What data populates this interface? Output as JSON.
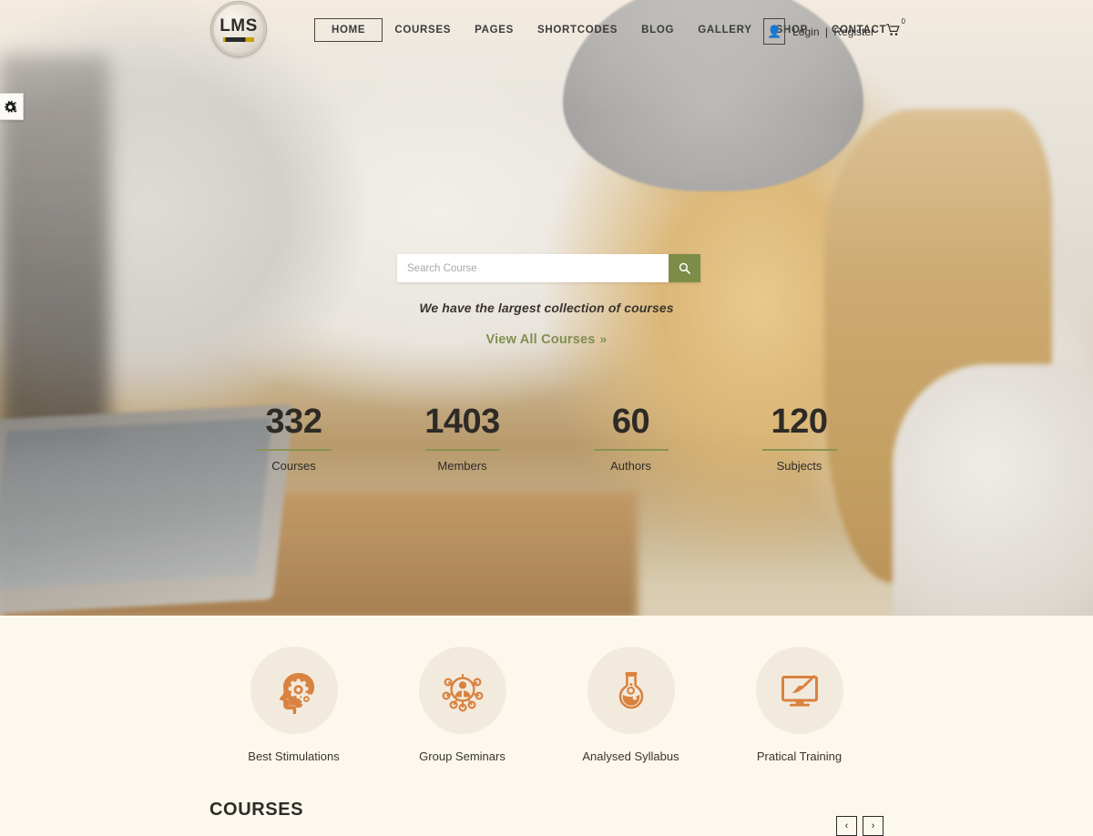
{
  "site": {
    "logo_text": "LMS",
    "accent_green": "#7d8c46",
    "accent_orange": "#d9823f",
    "section_bg": "#fdf8ee",
    "circle_bg": "#f3eade"
  },
  "header": {
    "nav_items": [
      {
        "label": "HOME",
        "active": true
      },
      {
        "label": "COURSES",
        "active": false
      },
      {
        "label": "PAGES",
        "active": false
      },
      {
        "label": "SHORTCODES",
        "active": false
      },
      {
        "label": "BLOG",
        "active": false
      },
      {
        "label": "GALLERY",
        "active": false
      },
      {
        "label": "SHOP",
        "active": false
      },
      {
        "label": "CONTACT",
        "active": false
      }
    ],
    "login_label": "Login",
    "separator": "|",
    "register_label": "Register",
    "cart_count": "0",
    "user_icon": "user-icon",
    "cart_icon": "cart-icon",
    "settings_icon": "settings-gears-icon"
  },
  "hero": {
    "search_placeholder": "Search Course",
    "search_value": "",
    "search_icon": "search-icon",
    "tagline": "We have the largest collection of courses",
    "view_all_label": "View All Courses",
    "view_all_chevron": "»"
  },
  "counters": [
    {
      "value": "332",
      "label": "Courses"
    },
    {
      "value": "1403",
      "label": "Members"
    },
    {
      "value": "60",
      "label": "Authors"
    },
    {
      "value": "120",
      "label": "Subjects"
    }
  ],
  "features": [
    {
      "label": "Best Stimulations",
      "icon": "head-gears-icon"
    },
    {
      "label": "Group Seminars",
      "icon": "network-person-icon"
    },
    {
      "label": "Analysed Syllabus",
      "icon": "flask-icon"
    },
    {
      "label": "Pratical Training",
      "icon": "monitor-brush-icon"
    }
  ],
  "courses_section": {
    "title": "COURSES",
    "prev_label": "‹",
    "next_label": "›"
  }
}
